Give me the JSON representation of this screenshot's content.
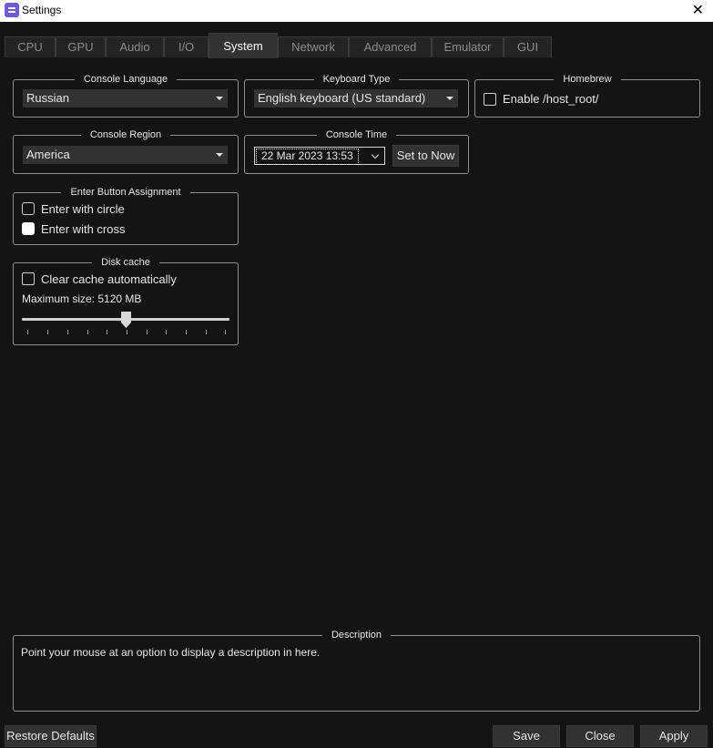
{
  "window": {
    "title": "Settings",
    "close_glyph": "✕"
  },
  "tabs": [
    {
      "label": "CPU"
    },
    {
      "label": "GPU"
    },
    {
      "label": "Audio"
    },
    {
      "label": "I/O"
    },
    {
      "label": "System"
    },
    {
      "label": "Network"
    },
    {
      "label": "Advanced"
    },
    {
      "label": "Emulator"
    },
    {
      "label": "GUI"
    }
  ],
  "active_tab": "System",
  "console_language": {
    "title": "Console Language",
    "value": "Russian"
  },
  "keyboard_type": {
    "title": "Keyboard Type",
    "value": "English keyboard (US standard)"
  },
  "homebrew": {
    "title": "Homebrew",
    "checkbox_label": "Enable /host_root/",
    "checked": false
  },
  "console_region": {
    "title": "Console Region",
    "value": "America"
  },
  "console_time": {
    "title": "Console Time",
    "value": "22 Mar 2023 13:53",
    "set_now_label": "Set to Now"
  },
  "enter_button": {
    "title": "Enter Button Assignment",
    "options": [
      {
        "label": "Enter with circle",
        "selected": false
      },
      {
        "label": "Enter with cross",
        "selected": true
      }
    ]
  },
  "disk_cache": {
    "title": "Disk cache",
    "checkbox_label": "Clear cache automatically",
    "checked": false,
    "max_size_label": "Maximum size: 5120 MB",
    "slider_fraction": 0.5
  },
  "description": {
    "title": "Description",
    "text": "Point your mouse at an option to display a description in here."
  },
  "buttons": {
    "restore": "Restore Defaults",
    "save": "Save",
    "close": "Close",
    "apply": "Apply"
  },
  "colors": {
    "background": "#141414",
    "control": "#323232",
    "border": "#909090",
    "accent_icon": "#6f5bd6"
  }
}
